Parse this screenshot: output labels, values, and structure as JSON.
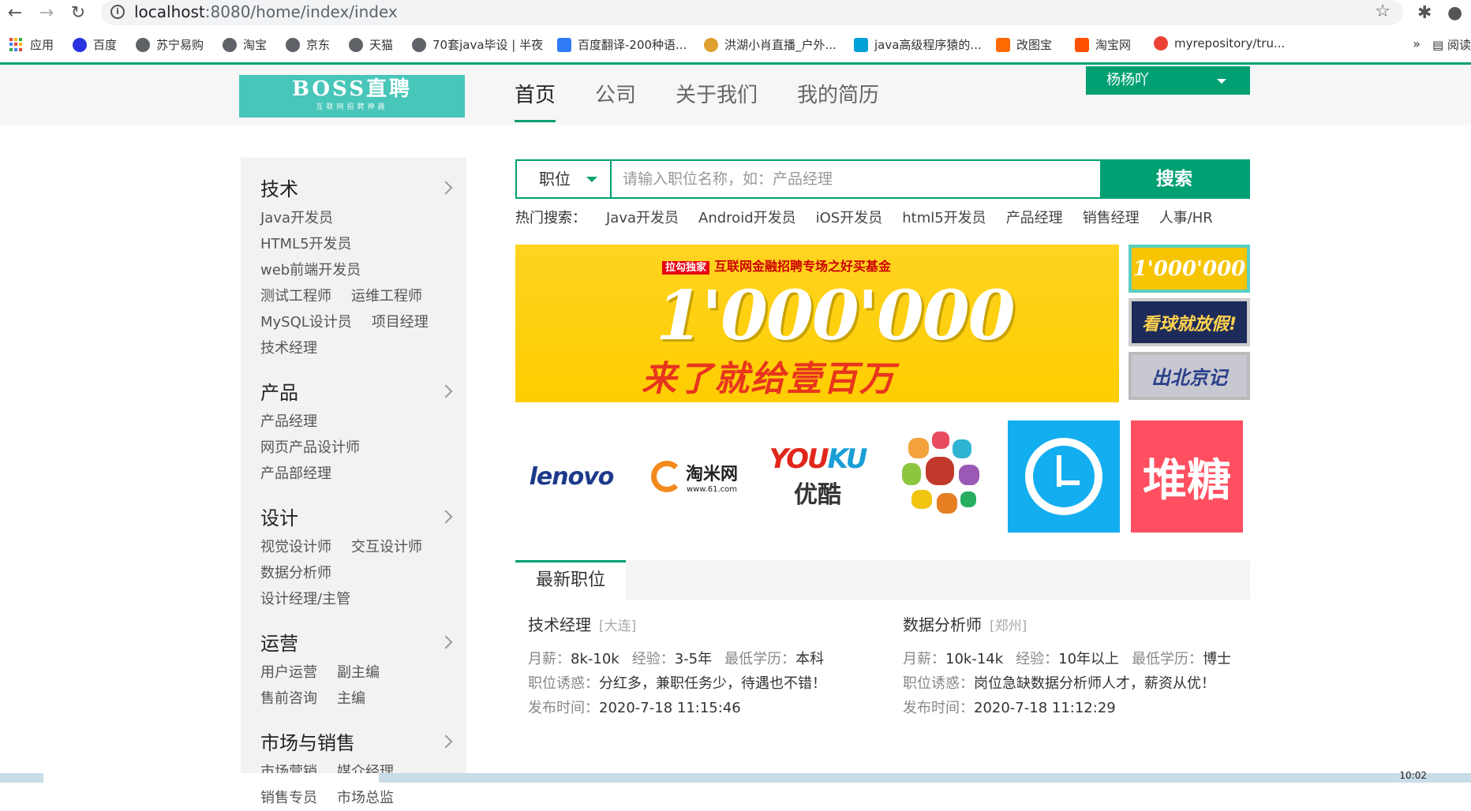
{
  "browser": {
    "url_host": "localhost",
    "url_path": ":8080/home/index/index",
    "bookmarks": [
      {
        "label": "应用"
      },
      {
        "label": "百度"
      },
      {
        "label": "苏宁易购"
      },
      {
        "label": "淘宝"
      },
      {
        "label": "京东"
      },
      {
        "label": "天猫"
      },
      {
        "label": "70套java毕设 | 半夜"
      },
      {
        "label": "百度翻译-200种语..."
      },
      {
        "label": "洪湖小肖直播_户外..."
      },
      {
        "label": "java高级程序猿的..."
      },
      {
        "label": "改图宝"
      },
      {
        "label": "淘宝网"
      },
      {
        "label": "myrepository/tru..."
      }
    ],
    "more": "»",
    "reading_list": "阅读"
  },
  "header": {
    "logo_main": "BOSS直聘",
    "logo_sub": "互联网招聘神器",
    "nav": [
      "首页",
      "公司",
      "关于我们",
      "我的简历"
    ],
    "user": "杨杨吖"
  },
  "sidebar": {
    "categories": [
      {
        "title": "技术",
        "items": [
          "Java开发员",
          "HTML5开发员",
          "web前端开发员",
          "测试工程师",
          "运维工程师",
          "MySQL设计员",
          "项目经理",
          "技术经理"
        ]
      },
      {
        "title": "产品",
        "items": [
          "产品经理",
          "网页产品设计师",
          "产品部经理"
        ]
      },
      {
        "title": "设计",
        "items": [
          "视觉设计师",
          "交互设计师",
          "数据分析师",
          "设计经理/主管"
        ]
      },
      {
        "title": "运营",
        "items": [
          "用户运营",
          "副主编",
          "售前咨询",
          "主编"
        ]
      },
      {
        "title": "市场与销售",
        "items": [
          "市场营销",
          "媒介经理",
          "销售专员",
          "市场总监"
        ]
      }
    ]
  },
  "search": {
    "type": "职位",
    "placeholder": "请输入职位名称，如：产品经理",
    "button": "搜索"
  },
  "hot": {
    "label": "热门搜索：",
    "items": [
      "Java开发员",
      "Android开发员",
      "iOS开发员",
      "html5开发员",
      "产品经理",
      "销售经理",
      "人事/HR"
    ]
  },
  "banner": {
    "tag": "拉勾独家",
    "headline": "互联网金融招聘专场之好买基金",
    "number": "1'000'000",
    "slogan": "来了就给壹百万"
  },
  "thumbs": [
    "1'000'000",
    "看球就放假!",
    "出北京记"
  ],
  "companies": {
    "lenovo": "lenovo",
    "taomi": "淘米网",
    "taomi_url": "www.61.com",
    "youku_a": "YOU",
    "youku_b": "KU",
    "youku_cn": "优酷",
    "duitang": "堆糖"
  },
  "latest": {
    "tab": "最新职位",
    "jobs": [
      {
        "title": "技术经理",
        "city": "[大连]",
        "salary_label": "月薪：",
        "salary": "8k-10k",
        "exp_label": "经验：",
        "exp": "3-5年",
        "edu_label": "最低学历：",
        "edu": "本科",
        "perk_label": "职位诱惑：",
        "perk": "分红多，兼职任务少，待遇也不错！",
        "time_label": "发布时间：",
        "time": "2020-7-18 11:15:46"
      },
      {
        "title": "数据分析师",
        "city": "[郑州]",
        "salary_label": "月薪：",
        "salary": "10k-14k",
        "exp_label": "经验：",
        "exp": "10年以上",
        "edu_label": "最低学历：",
        "edu": "博士",
        "perk_label": "职位诱惑：",
        "perk": "岗位急缺数据分析师人才，薪资从优！",
        "time_label": "发布时间：",
        "time": "2020-7-18 11:12:29"
      }
    ]
  },
  "taskbar": {
    "time": "10:02"
  },
  "colors": {
    "accent": "#00a073",
    "logo_bg": "#47c6b9"
  }
}
